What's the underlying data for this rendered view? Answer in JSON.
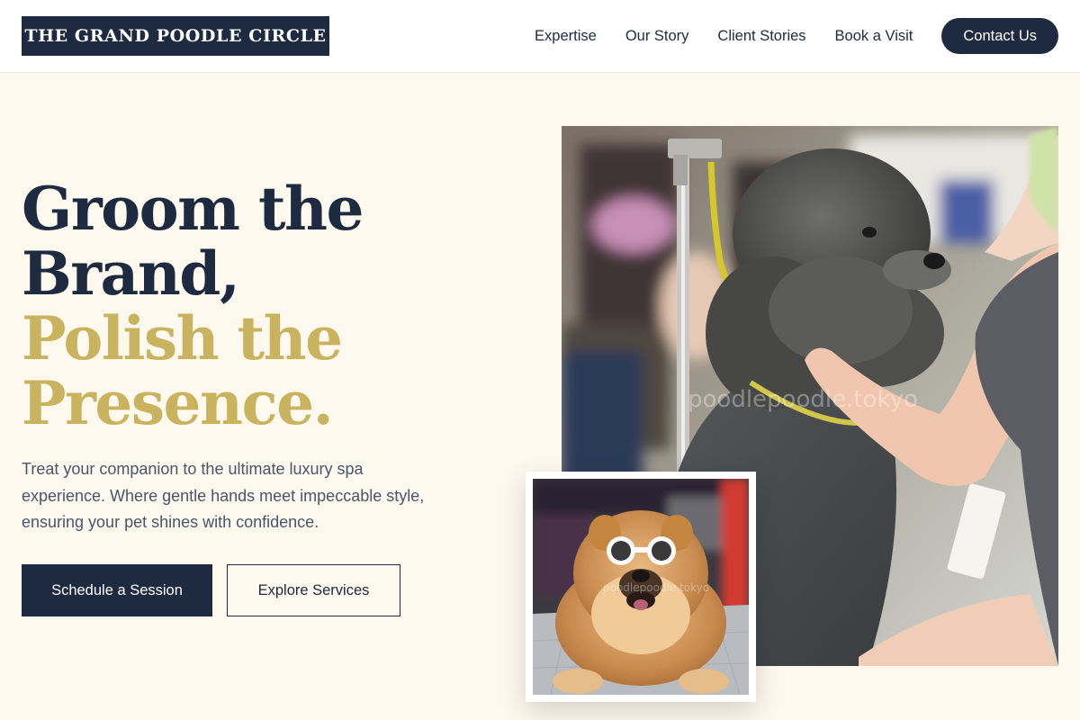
{
  "header": {
    "logo": "THE GRAND POODLE CIRCLE",
    "nav": [
      "Expertise",
      "Our Story",
      "Client Stories",
      "Book a Visit"
    ],
    "contact_label": "Contact Us"
  },
  "hero": {
    "headline_dark": [
      "Groom the",
      "Brand,"
    ],
    "headline_gold": [
      "Polish the",
      "Presence."
    ],
    "subtext": "Treat your companion to the ultimate luxury spa experience. Where gentle hands meet impeccable style, ensuring your pet shines with confidence.",
    "primary_cta": "Schedule a Session",
    "secondary_cta": "Explore Services"
  },
  "images": {
    "main_watermark": "poodlepoodle.tokyo",
    "small_watermark": "poodlepoodle.tokyo"
  },
  "colors": {
    "navy": "#1e2a40",
    "gold": "#c9b35f",
    "cream": "#fdf9ef"
  }
}
